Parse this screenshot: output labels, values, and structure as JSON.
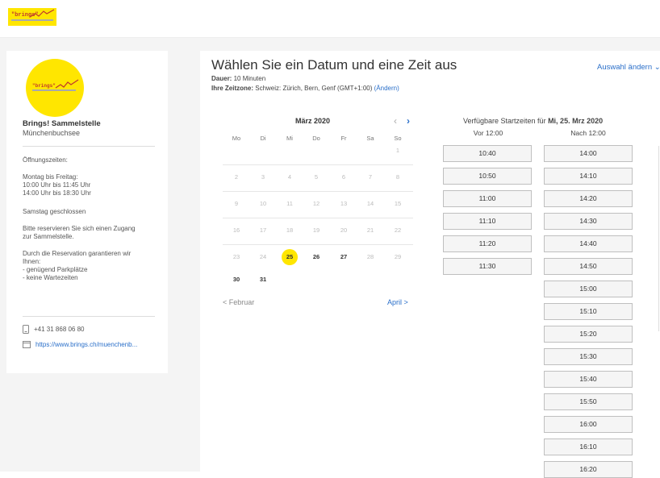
{
  "header": {
    "logo_text": "\"brings\"",
    "logo_alt": "brings logo"
  },
  "sidebar": {
    "logo_text": "\"brings\"",
    "org_name": "Brings! Sammelstelle",
    "org_city": "Münchenbuchsee",
    "hours_title": "Öffnungszeiten:",
    "weekday_hours_title": "Montag bis Freitag:",
    "weekday_hours_1": "10:00 Uhr bis 11:45 Uhr",
    "weekday_hours_2": "14:00 Uhr bis 18:30 Uhr",
    "saturday": "Samstag geschlossen",
    "note_1": "Bitte reservieren Sie sich einen Zugang",
    "note_2": "zur Sammelstelle.",
    "benefit_title_1": "Durch die Reservation garantieren wir",
    "benefit_title_2": "Ihnen:",
    "benefit_1": "- genügend Parkplätze",
    "benefit_2": "- keine Wartezeiten",
    "phone": "+41 31 868 06 80",
    "website": "https://www.brings.ch/muenchenb..."
  },
  "main": {
    "title": "Wählen Sie ein Datum und eine Zeit aus",
    "change_selection": "Auswahl ändern ⌄",
    "duration_label": "Dauer:",
    "duration_value": " 10 Minuten",
    "timezone_label": "Ihre Zeitzone:",
    "timezone_value": " Schweiz: Zürich, Bern, Genf (GMT+1:00) ",
    "timezone_change": "(Ändern)"
  },
  "calendar": {
    "month": "März 2020",
    "prev_icon": "‹",
    "next_icon": "›",
    "weekdays": [
      "Mo",
      "Di",
      "Mi",
      "Do",
      "Fr",
      "Sa",
      "So"
    ],
    "weeks": [
      [
        "",
        "",
        "",
        "",
        "",
        "",
        "1"
      ],
      [
        "2",
        "3",
        "4",
        "5",
        "6",
        "7",
        "8"
      ],
      [
        "9",
        "10",
        "11",
        "12",
        "13",
        "14",
        "15"
      ],
      [
        "16",
        "17",
        "18",
        "19",
        "20",
        "21",
        "22"
      ],
      [
        "23",
        "24",
        "25",
        "26",
        "27",
        "28",
        "29"
      ],
      [
        "30",
        "31",
        "",
        "",
        "",
        "",
        ""
      ]
    ],
    "active_days": [
      "25",
      "26",
      "27",
      "30",
      "31"
    ],
    "selected_day": "25",
    "prev_month": "< Februar",
    "next_month": "April >"
  },
  "slots": {
    "available_prefix": "Verfügbare Startzeiten für ",
    "available_date": "Mi, 25. Mrz 2020",
    "morning_header": "Vor 12:00",
    "afternoon_header": "Nach 12:00",
    "morning": [
      "10:40",
      "10:50",
      "11:00",
      "11:10",
      "11:20",
      "11:30"
    ],
    "afternoon": [
      "14:00",
      "14:10",
      "14:20",
      "14:30",
      "14:40",
      "14:50",
      "15:00",
      "15:10",
      "15:20",
      "15:30",
      "15:40",
      "15:50",
      "16:00",
      "16:10",
      "16:20"
    ]
  },
  "colors": {
    "brand_yellow": "#ffe600",
    "link_blue": "#2a6fc9"
  }
}
